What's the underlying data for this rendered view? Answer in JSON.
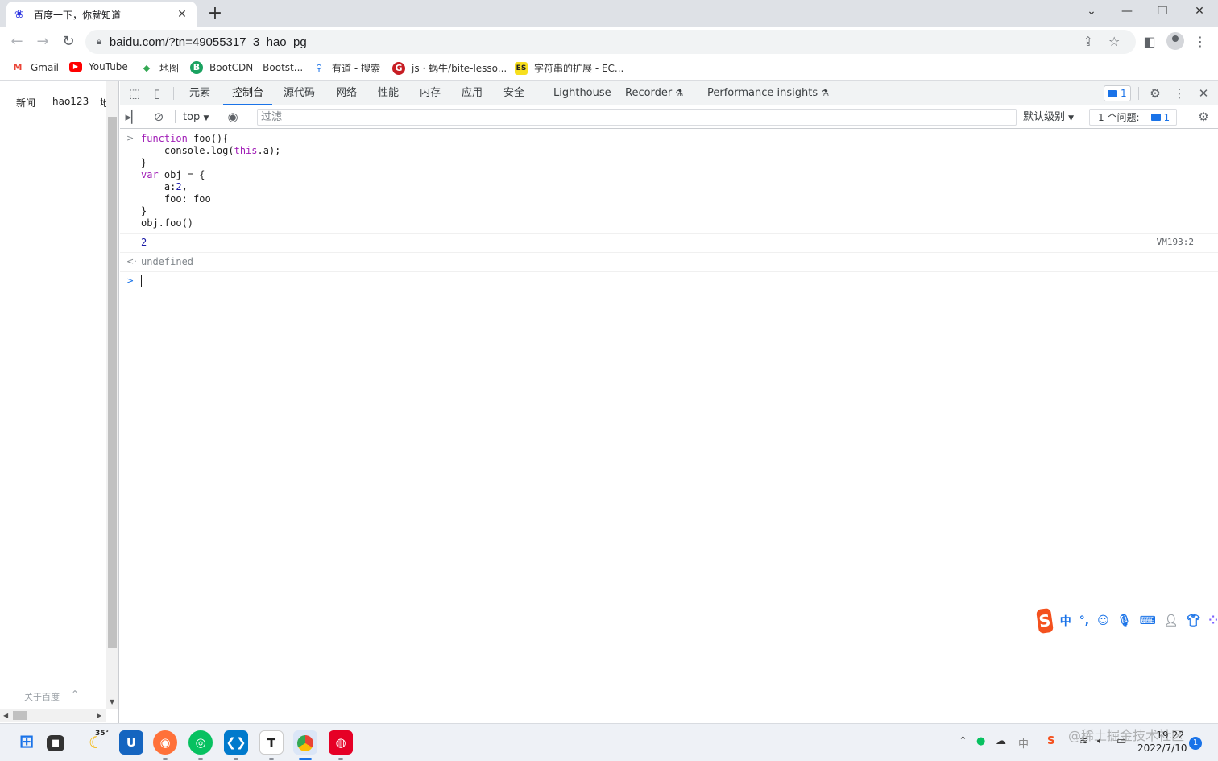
{
  "browser": {
    "tab_title": "百度一下，你就知道",
    "url": "baidu.com/?tn=49055317_3_hao_pg"
  },
  "bookmarks": [
    {
      "label": "Gmail",
      "icon": "gmail-icon",
      "color": "#ea4335"
    },
    {
      "label": "YouTube",
      "icon": "youtube-icon",
      "color": "#ff0000"
    },
    {
      "label": "地图",
      "icon": "maps-icon",
      "color": "#34a853"
    },
    {
      "label": "BootCDN - Bootst...",
      "icon": "bootcdn-icon",
      "color": "#1aa260"
    },
    {
      "label": "有道 - 搜索",
      "icon": "search-icon",
      "color": "#1a73e8"
    },
    {
      "label": "js · 蜗牛/bite-lesso...",
      "icon": "gitee-icon",
      "color": "#c71d23"
    },
    {
      "label": "字符串的扩展 - EC...",
      "icon": "es-icon",
      "color": "#f7df1e"
    }
  ],
  "page": {
    "links": [
      "新闻",
      "hao123",
      "地"
    ],
    "footer": "关于百度"
  },
  "devtools": {
    "tabs": [
      "元素",
      "控制台",
      "源代码",
      "网络",
      "性能",
      "内存",
      "应用",
      "安全",
      "Lighthouse",
      "Recorder",
      "Performance insights"
    ],
    "active_tab": "控制台",
    "message_count": "1",
    "context": "top",
    "filter_placeholder": "过滤",
    "levels": "默认级别",
    "issues_label": "1 个问题:",
    "issues_count": "1"
  },
  "console": {
    "input_lines": [
      {
        "parts": [
          {
            "t": "function",
            "c": "kw"
          },
          {
            "t": " foo(){",
            "c": ""
          }
        ]
      },
      {
        "parts": [
          {
            "t": "    console.log(",
            "c": ""
          },
          {
            "t": "this",
            "c": "kw"
          },
          {
            "t": ".a);",
            "c": ""
          }
        ]
      },
      {
        "parts": [
          {
            "t": "}",
            "c": ""
          }
        ]
      },
      {
        "parts": [
          {
            "t": "var",
            "c": "kw"
          },
          {
            "t": " obj = {",
            "c": ""
          }
        ]
      },
      {
        "parts": [
          {
            "t": "    a:",
            "c": ""
          },
          {
            "t": "2",
            "c": "num"
          },
          {
            "t": ",",
            "c": ""
          }
        ]
      },
      {
        "parts": [
          {
            "t": "    foo: foo",
            "c": ""
          }
        ]
      },
      {
        "parts": [
          {
            "t": "}",
            "c": ""
          }
        ]
      },
      {
        "parts": [
          {
            "t": "obj.foo()",
            "c": ""
          }
        ]
      }
    ],
    "log_output": "2",
    "log_source": "VM193:2",
    "return_value": "undefined"
  },
  "ime": {
    "mode": "中",
    "punct": "°,",
    "logo": "S"
  },
  "taskbar": {
    "weather_temp": "35°",
    "time": "19:22",
    "date": "2022/7/10",
    "notifications": "1"
  },
  "watermark": "@稀土掘金技术社区"
}
